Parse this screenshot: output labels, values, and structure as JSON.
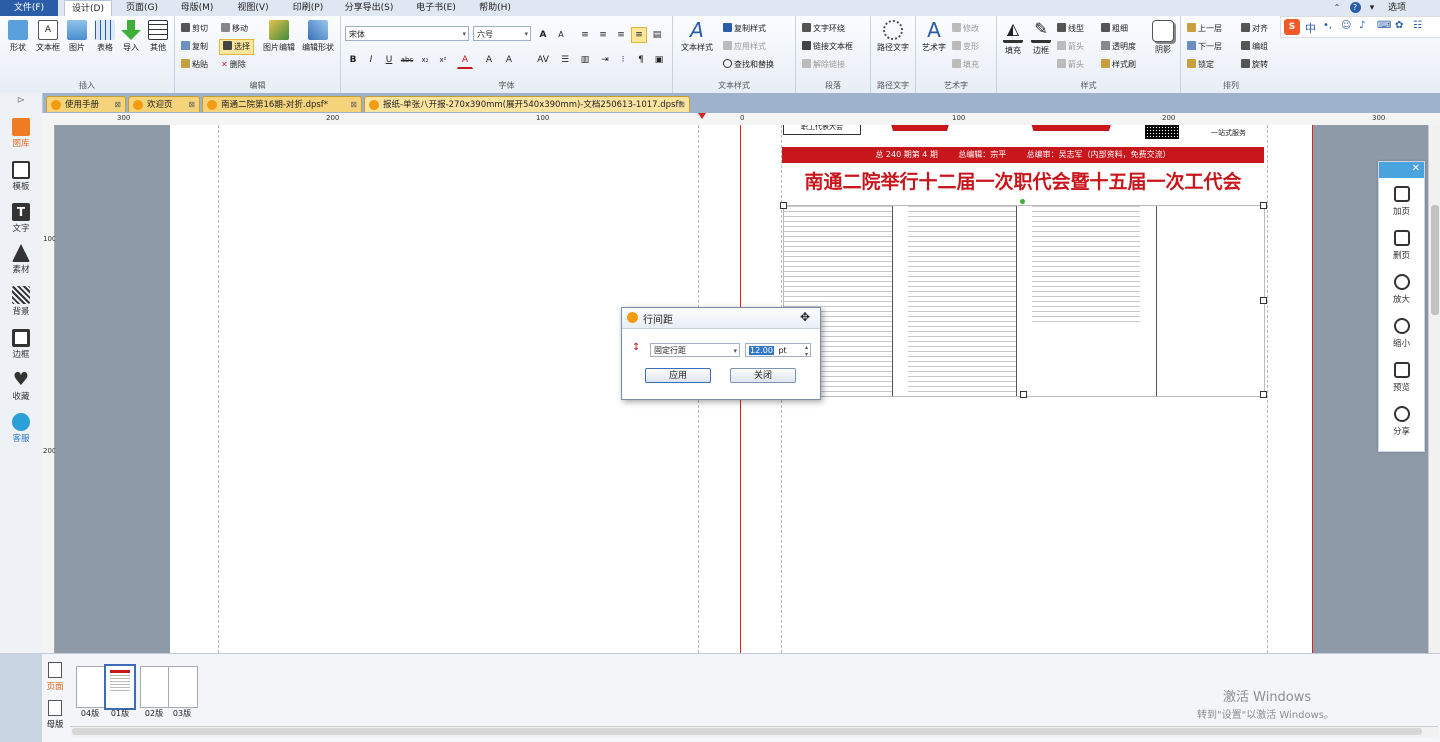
{
  "menubar": {
    "items": [
      "文件(F)",
      "设计(D)",
      "页面(G)",
      "母版(M)",
      "视图(V)",
      "印刷(P)",
      "分享导出(S)",
      "电子书(E)",
      "帮助(H)"
    ],
    "options_label": "选项"
  },
  "ribbon": {
    "insert": {
      "label": "插入",
      "buttons": [
        "形状",
        "文本框",
        "图片",
        "表格",
        "导入",
        "其他"
      ]
    },
    "edit": {
      "label": "编辑",
      "cut": "剪切",
      "copy": "复制",
      "paste": "粘贴",
      "move": "移动",
      "select": "选择",
      "delete": "删除",
      "image_edit": "图片编辑",
      "shape_edit": "编辑形状"
    },
    "font": {
      "label": "字体",
      "font_name": "宋体",
      "font_size": "六号"
    },
    "text_style": {
      "label": "文本样式",
      "big": "文本样式",
      "copy_style": "复制样式",
      "apply_style": "应用样式",
      "find_replace": "查找和替换"
    },
    "paragraph": {
      "label": "段落",
      "wrap": "文字环绕",
      "link": "链接文本框",
      "unlink": "解除链接"
    },
    "path_text": {
      "label": "路径文字",
      "big": "路径文字"
    },
    "art_text": {
      "label": "艺术字",
      "big": "艺术字",
      "modify": "修改",
      "deform": "变形",
      "fill": "填充"
    },
    "style": {
      "label": "样式",
      "fill": "填充",
      "border": "边框",
      "line": "线型",
      "weight": "粗细",
      "arrow": "箭头",
      "transparency": "透明度",
      "tail": "箭头",
      "brush": "样式刷",
      "shadow": "阴影"
    },
    "arrange": {
      "label": "排列",
      "up": "上一层",
      "down": "下一层",
      "lock": "锁定",
      "align": "对齐",
      "group": "编组",
      "rotate": "旋转"
    }
  },
  "tabs": [
    {
      "label": "使用手册"
    },
    {
      "label": "欢迎页"
    },
    {
      "label": "南通二院第16期-对折.dpsf*"
    },
    {
      "label": "报纸-单张八开报-270x390mm(展开540x390mm)-文档250613-1017.dpsf*"
    }
  ],
  "leftbar": [
    "图库",
    "模板",
    "文字",
    "素材",
    "背景",
    "边框",
    "收藏",
    "客服"
  ],
  "ruler_h": [
    "300",
    "200",
    "100",
    "0",
    "100",
    "200",
    "300"
  ],
  "ruler_v": [
    "100",
    "200"
  ],
  "newspaper": {
    "service": "一站式服务",
    "infobar": "总 240 期第 4 期        总编辑：宗平        总编审：吴志军（内部资料，免费交流）",
    "headline": "南通二院举行十二届一次职代会暨十五届一次工代会",
    "box_label": "职工代表大会"
  },
  "dialog": {
    "title": "行间距",
    "mode": "固定行距",
    "value": "12.00",
    "unit": "pt",
    "apply": "应用",
    "close": "关闭"
  },
  "rpanel": [
    "加页",
    "删页",
    "放大",
    "缩小",
    "预览",
    "分享"
  ],
  "thumbs": {
    "page_tab": "页面",
    "master_tab": "母版",
    "pages": [
      "04版",
      "01版",
      "02版",
      "03版"
    ]
  },
  "watermark": {
    "line1": "激活 Windows",
    "line2": "转到\"设置\"以激活 Windows。"
  },
  "colors": {
    "accent": "#2a5ca8",
    "newspaper_red": "#c8161d",
    "tab_yellow": "#f4d37a"
  }
}
